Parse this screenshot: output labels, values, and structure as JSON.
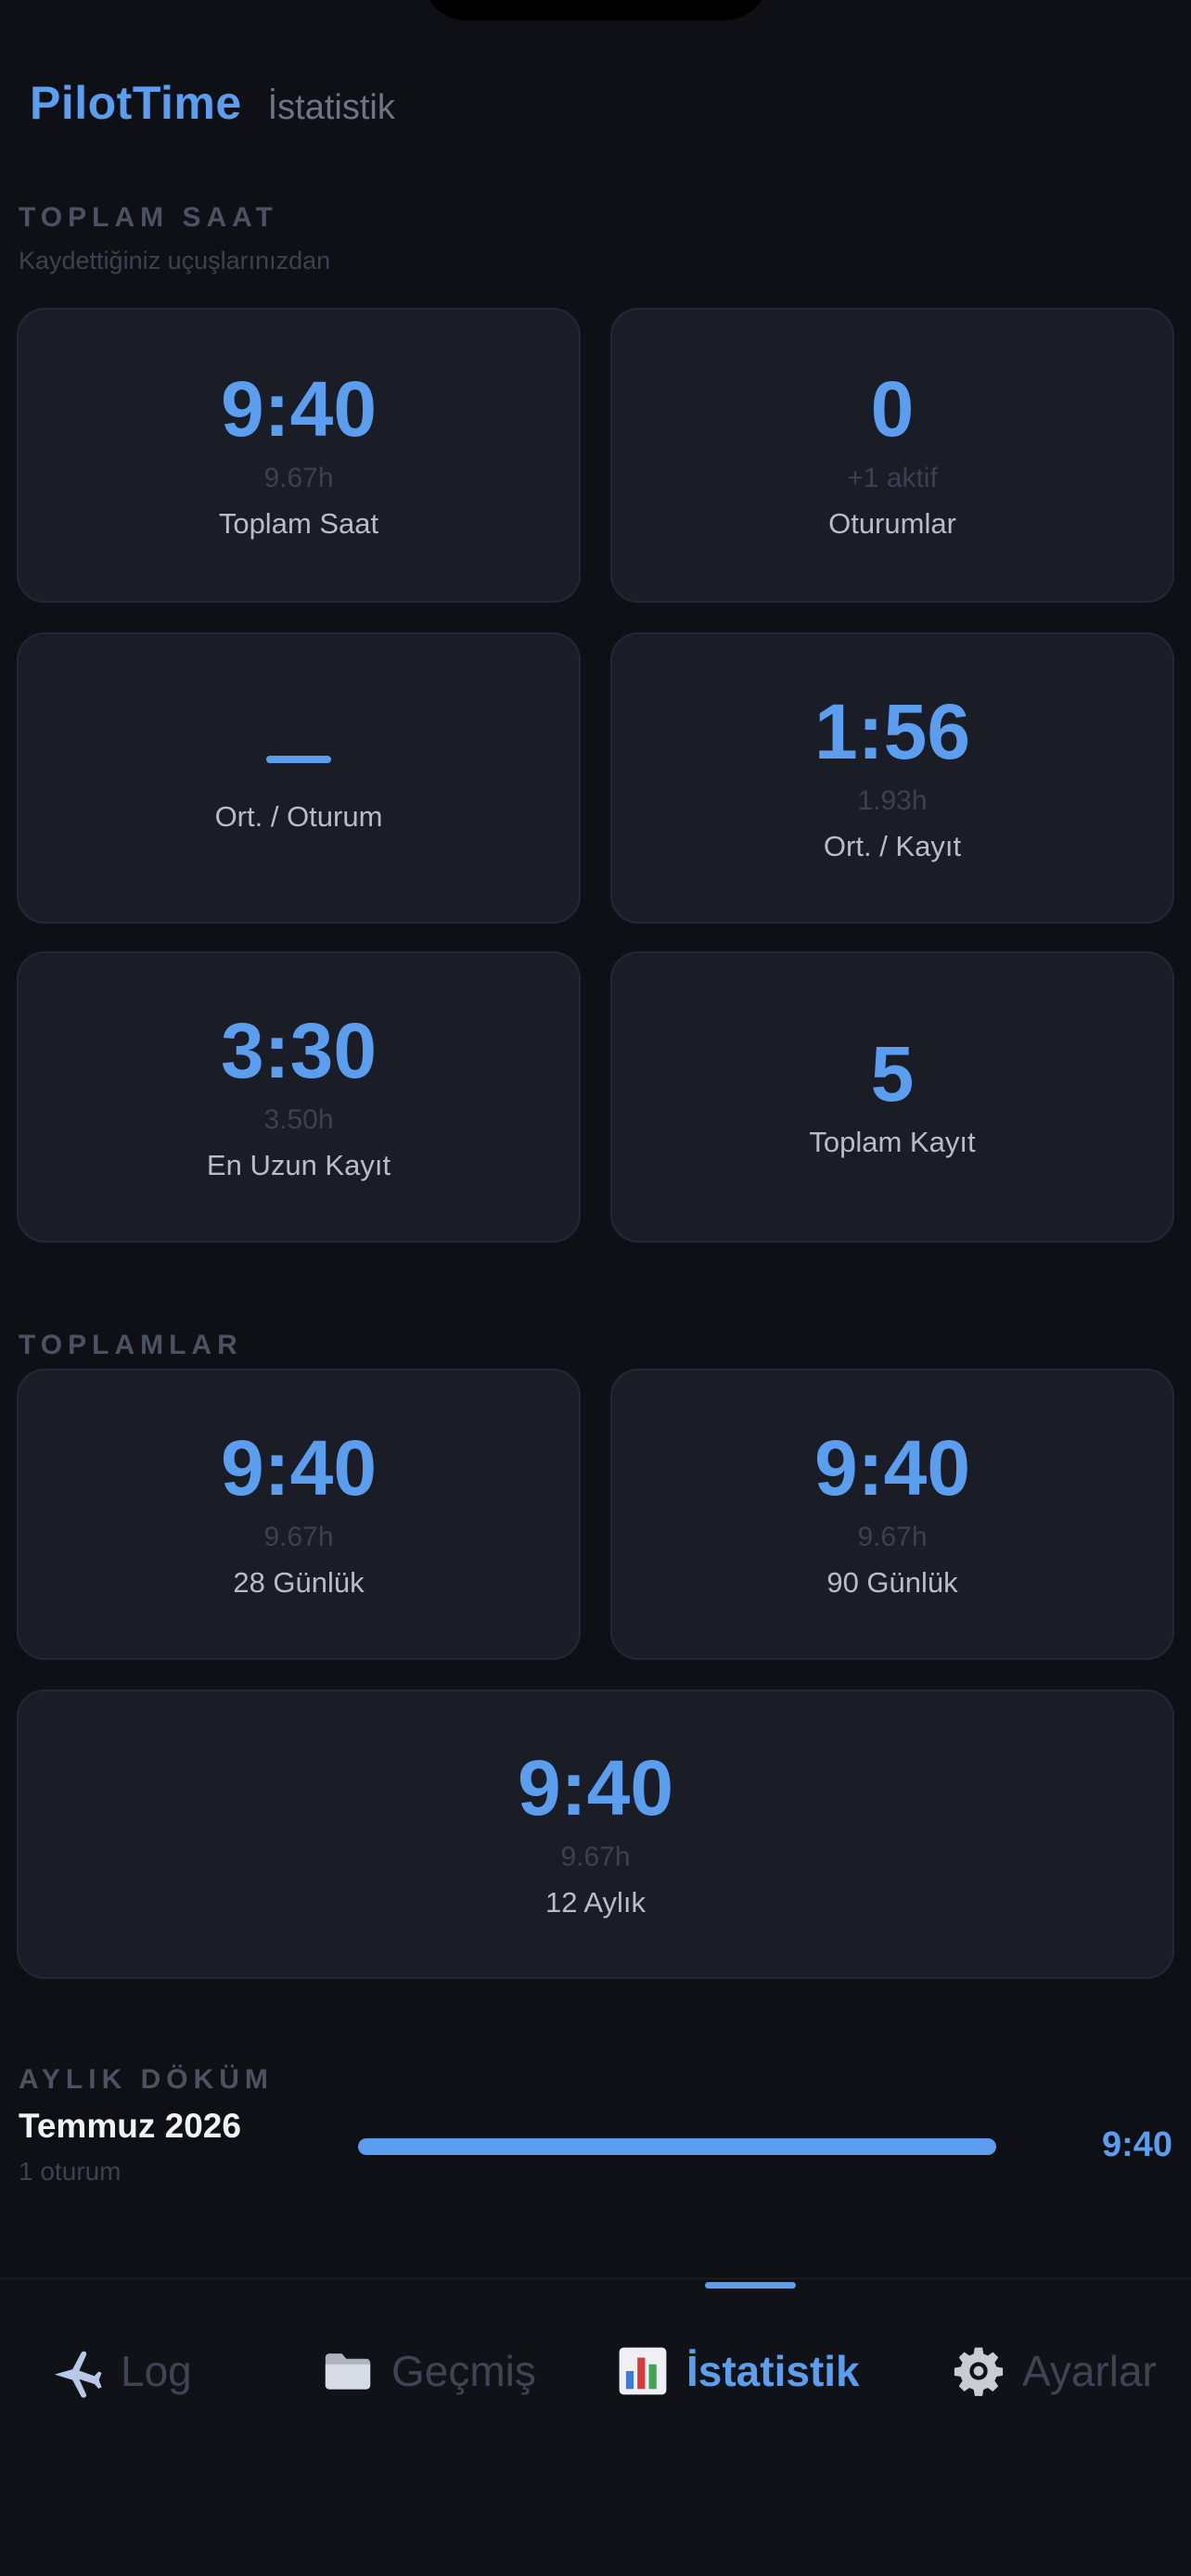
{
  "header": {
    "app_title": "PilotTime",
    "page_title": "İstatistik"
  },
  "total_section": {
    "label": "TOPLAM SAAT",
    "sublabel": "Kaydettiğiniz uçuşlarınızdan",
    "cards": [
      {
        "value": "9:40",
        "sub": "9.67h",
        "label": "Toplam Saat"
      },
      {
        "value": "0",
        "sub": "+1 aktif",
        "label": "Oturumlar"
      },
      {
        "value": "",
        "sub": "",
        "label": "Ort. / Oturum"
      },
      {
        "value": "1:56",
        "sub": "1.93h",
        "label": "Ort. / Kayıt"
      },
      {
        "value": "3:30",
        "sub": "3.50h",
        "label": "En Uzun Kayıt"
      },
      {
        "value": "5",
        "sub": "",
        "label": "Toplam Kayıt"
      }
    ]
  },
  "totals_section": {
    "label": "TOPLAMLAR",
    "cards": [
      {
        "value": "9:40",
        "sub": "9.67h",
        "label": "28 Günlük"
      },
      {
        "value": "9:40",
        "sub": "9.67h",
        "label": "90 Günlük"
      },
      {
        "value": "9:40",
        "sub": "9.67h",
        "label": "12 Aylık"
      }
    ]
  },
  "monthly_section": {
    "label": "AYLIK DÖKÜM",
    "rows": [
      {
        "month": "Temmuz 2026",
        "count": "1 oturum",
        "total": "9:40",
        "fraction": 1.0
      }
    ]
  },
  "tabs": [
    {
      "label": "Log",
      "icon": "airplane-icon",
      "active": false
    },
    {
      "label": "Geçmiş",
      "icon": "folder-icon",
      "active": false
    },
    {
      "label": "İstatistik",
      "icon": "bar-chart-icon",
      "active": true
    },
    {
      "label": "Ayarlar",
      "icon": "gear-icon",
      "active": false
    }
  ],
  "colors": {
    "accent": "#5b9ef0",
    "background": "#0f1016",
    "card": "#1a1c26"
  }
}
